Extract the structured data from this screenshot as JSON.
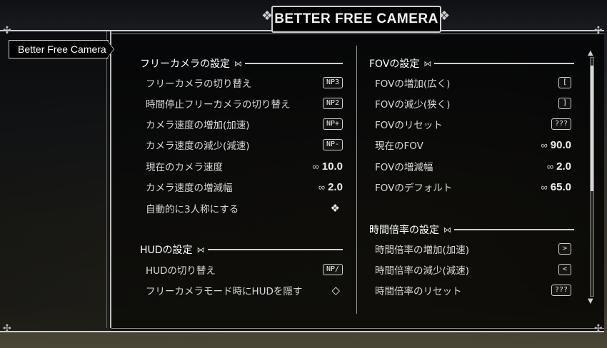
{
  "title": "BETTER FREE CAMERA",
  "nav": {
    "items": [
      {
        "label": "Better Free Camera"
      }
    ]
  },
  "sections": {
    "free_camera": {
      "header": "フリーカメラの設定",
      "rows": [
        {
          "label": "フリーカメラの切り替え",
          "key": "NP3"
        },
        {
          "label": "時間停止フリーカメラの切り替え",
          "key": "NP2"
        },
        {
          "label": "カメラ速度の増加(加速)",
          "key": "NP+"
        },
        {
          "label": "カメラ速度の減少(減速)",
          "key": "NP-"
        },
        {
          "label": "現在のカメラ速度",
          "value": "10.0"
        },
        {
          "label": "カメラ速度の増減幅",
          "value": "2.0"
        },
        {
          "label": "自動的に3人称にする",
          "toggle_icon": "toggle-diamond-checked"
        }
      ]
    },
    "hud": {
      "header": "HUDの設定",
      "rows": [
        {
          "label": "HUDの切り替え",
          "key": "NP/"
        },
        {
          "label": "フリーカメラモード時にHUDを隠す",
          "toggle_icon": "toggle-diamond-empty"
        }
      ]
    },
    "fov": {
      "header": "FOVの設定",
      "rows": [
        {
          "label": "FOVの増加(広く)",
          "key": "["
        },
        {
          "label": "FOVの減少(狭く)",
          "key": "]"
        },
        {
          "label": "FOVのリセット",
          "key": "???"
        },
        {
          "label": "現在のFOV",
          "value": "90.0"
        },
        {
          "label": "FOVの増減幅",
          "value": "2.0"
        },
        {
          "label": "FOVのデフォルト",
          "value": "65.0"
        }
      ]
    },
    "time": {
      "header": "時間倍率の設定",
      "rows": [
        {
          "label": "時間倍率の増加(加速)",
          "key": ">"
        },
        {
          "label": "時間倍率の減少(減速)",
          "key": "<"
        },
        {
          "label": "時間倍率のリセット",
          "key": "???"
        }
      ]
    }
  },
  "glyphs": {
    "slider_marker": "∞",
    "header_ornament": "⋈",
    "checked": "❖",
    "empty": "◇"
  },
  "colors": {
    "panel_bg": "#000000",
    "border": "#cfcfcf",
    "text": "#e6e6e6"
  }
}
